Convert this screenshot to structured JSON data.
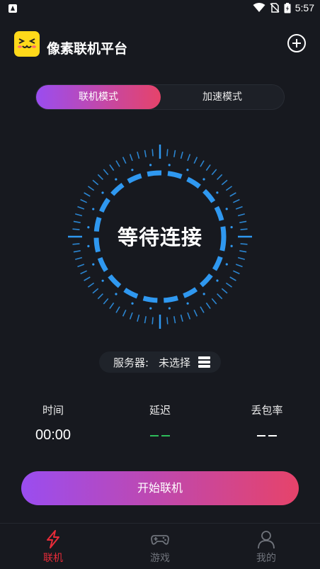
{
  "status_bar": {
    "time": "5:57"
  },
  "header": {
    "title": "像素联机平台"
  },
  "mode_tabs": [
    {
      "label": "联机模式",
      "active": true
    },
    {
      "label": "加速模式",
      "active": false
    }
  ],
  "dial": {
    "status": "等待连接"
  },
  "server": {
    "label": "服务器:",
    "value": "未选择"
  },
  "stats": {
    "time": {
      "label": "时间",
      "value": "00:00"
    },
    "delay": {
      "label": "延迟",
      "value": "— —"
    },
    "loss": {
      "label": "丢包率",
      "value": "— —"
    }
  },
  "start_button": {
    "label": "开始联机"
  },
  "bottom_nav": [
    {
      "label": "联机",
      "icon": "lightning-icon",
      "active": true
    },
    {
      "label": "游戏",
      "icon": "gamepad-icon",
      "active": false
    },
    {
      "label": "我的",
      "icon": "user-icon",
      "active": false
    }
  ],
  "colors": {
    "background": "#17191f",
    "accent_start": "#9a4df0",
    "accent_end": "#e6436a",
    "dial_blue": "#2f98f0",
    "nav_active": "#e62b38",
    "delay_green": "#2ebc5a"
  }
}
